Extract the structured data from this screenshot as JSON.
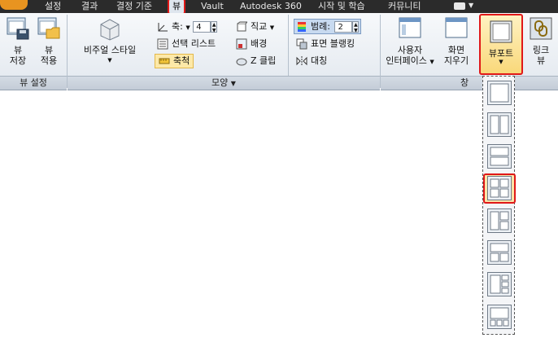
{
  "tabs": [
    "설정",
    "결과",
    "결정 기준",
    "뷰",
    "Vault",
    "Autodesk 360",
    "시작 및 학습",
    "커뮤니티"
  ],
  "view_settings": {
    "save_view_line1": "뷰",
    "save_view_line2": "저장",
    "apply_view_line1": "뷰",
    "apply_view_line2": "적용",
    "panel_label": "뷰 설정"
  },
  "appearance": {
    "visual_style": "비주얼 스타일",
    "axis_label": "축:",
    "axis_value": "4",
    "ortho": "직교",
    "select_list": "선택 리스트",
    "background": "배경",
    "scale": "축척",
    "zclip": "Z 클립",
    "panel_label": "모양"
  },
  "legend": {
    "legend_label": "범례:",
    "legend_value": "2",
    "surface_blanking": "표면 블랭킹",
    "symmetry": "대칭"
  },
  "window": {
    "ui_line1": "사용자",
    "ui_line2": "인터페이스",
    "clear_line1": "화면",
    "clear_line2": "지우기",
    "viewport": "뷰포트",
    "link_line1": "링크",
    "link_line2": "뷰",
    "panel_label": "창"
  }
}
